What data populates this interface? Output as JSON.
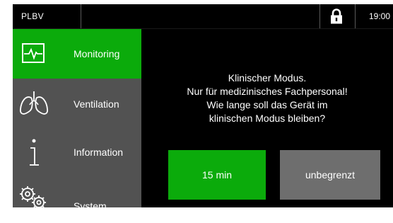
{
  "header": {
    "device_name": "PLBV",
    "time": "19:00",
    "lock_icon": "lock-icon"
  },
  "sidebar": {
    "items": [
      {
        "label": "Monitoring",
        "icon": "monitor-waveform-icon",
        "active": true
      },
      {
        "label": "Ventilation",
        "icon": "lungs-icon",
        "active": false
      },
      {
        "label": "Information",
        "icon": "info-icon",
        "active": false
      },
      {
        "label": "System",
        "icon": "gears-icon",
        "active": false
      }
    ]
  },
  "dialog": {
    "lines": [
      "Klinischer Modus.",
      "Nur für medizinisches Fachpersonal!",
      "Wie lange soll das Gerät im",
      "klinischen Modus bleiben?"
    ],
    "option_15": "15 min",
    "option_unlimited": "unbegrenzt"
  },
  "colors": {
    "accent_green": "#0bab0b",
    "sidebar_gray": "#525252",
    "button_gray": "#6e6e6e",
    "background": "#000000"
  }
}
